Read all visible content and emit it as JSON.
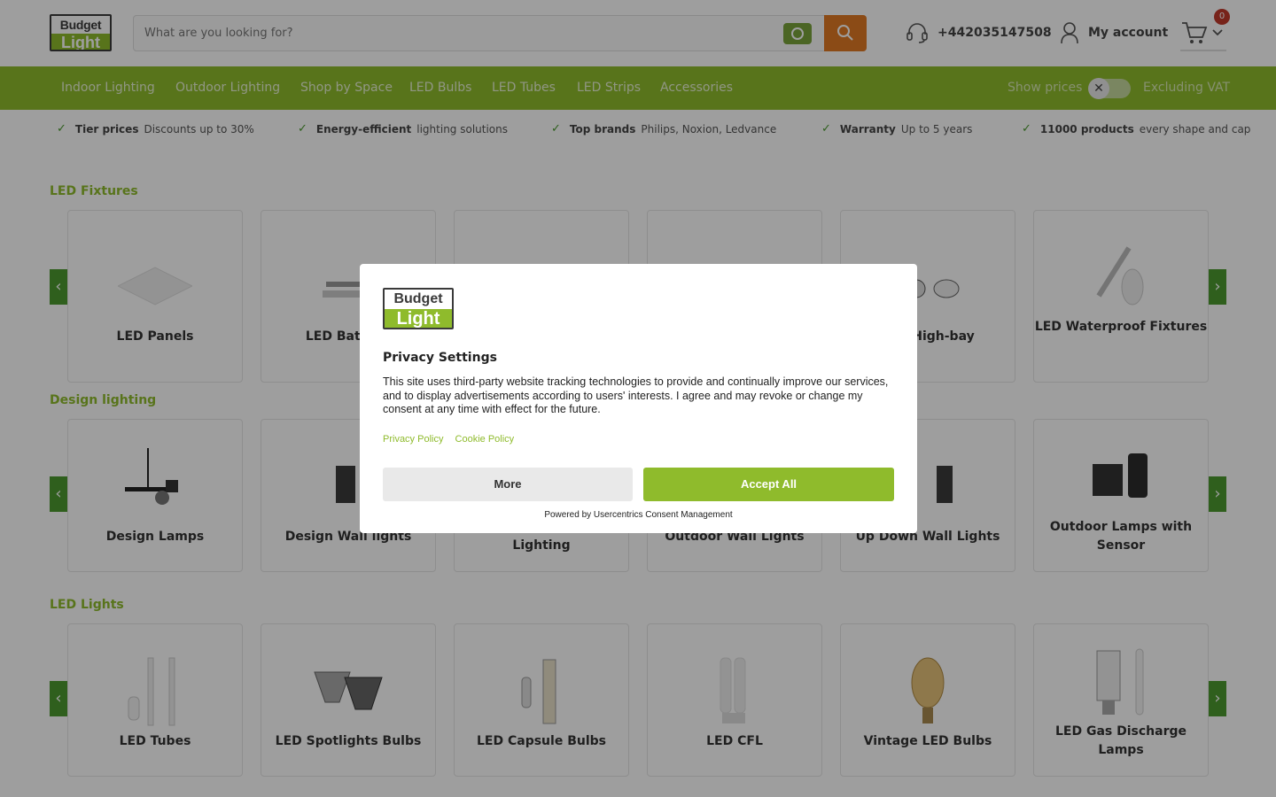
{
  "header": {
    "logo_top": "Budget",
    "logo_bottom": "Light",
    "search_placeholder": "What are you looking for?",
    "phone": "+442035147508",
    "account_label": "My account",
    "cart_count": "0"
  },
  "nav": {
    "items": [
      "Indoor Lighting",
      "Outdoor Lighting",
      "Shop by Space",
      "LED Bulbs",
      "LED Tubes",
      "LED Strips",
      "Accessories"
    ],
    "show_prices": "Show prices",
    "vat_label": "Excluding VAT",
    "toggle_symbol": "✕"
  },
  "usps": [
    {
      "bold": "Tier prices",
      "text": "Discounts up to 30%"
    },
    {
      "bold": "Energy-efficient",
      "text": "lighting solutions"
    },
    {
      "bold": "Top brands",
      "text": "Philips, Noxion, Ledvance"
    },
    {
      "bold": "Warranty",
      "text": "Up to 5 years"
    },
    {
      "bold": "11000 products",
      "text": "every shape and cap"
    }
  ],
  "sections": [
    {
      "title": "LED Fixtures",
      "cards": [
        "LED Panels",
        "LED Battens",
        "",
        "",
        "LED High-bay",
        "LED Waterproof Fixtures"
      ]
    },
    {
      "title": "Design lighting",
      "cards": [
        "Design Lamps",
        "Design Wall lights",
        "Lighting",
        "Outdoor Wall Lights",
        "Up Down Wall Lights",
        "Outdoor Lamps with Sensor"
      ]
    },
    {
      "title": "LED Lights",
      "cards": [
        "LED Tubes",
        "LED Spotlights Bulbs",
        "LED Capsule Bulbs",
        "LED CFL",
        "Vintage LED Bulbs",
        "LED Gas Discharge Lamps"
      ]
    }
  ],
  "modal": {
    "logo_top": "Budget",
    "logo_bottom": "Light",
    "title": "Privacy Settings",
    "body": "This site uses third-party website tracking technologies to provide and continually improve our services, and to display advertisements according to users' interests. I agree and may revoke or change my consent at any time with effect for the future.",
    "privacy_link": "Privacy Policy",
    "cookie_link": "Cookie Policy",
    "more_button": "More",
    "accept_button": "Accept All",
    "powered_by": "Powered by Usercentrics Consent Management"
  },
  "colors": {
    "brand_green": "#8fbb2c",
    "dark_green": "#4c9a30",
    "search_orange": "#e07a25"
  }
}
